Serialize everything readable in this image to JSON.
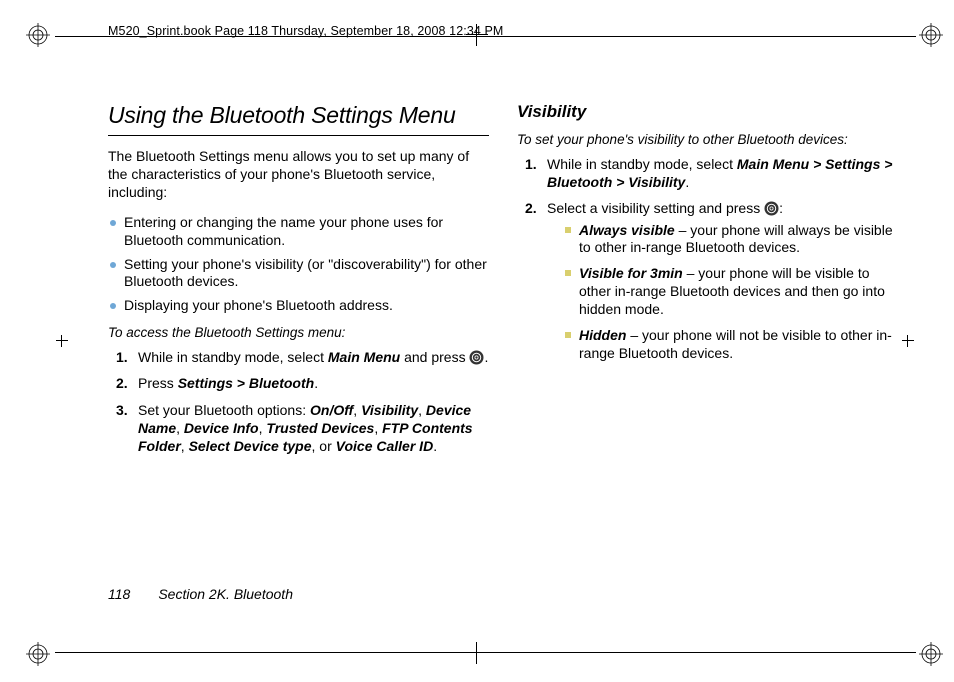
{
  "book_header": "M520_Sprint.book  Page 118  Thursday, September 18, 2008  12:34 PM",
  "left": {
    "h1": "Using the Bluetooth Settings Menu",
    "intro": "The Bluetooth Settings menu allows you to set up many of the characteristics of your phone's Bluetooth service, including:",
    "bullets": {
      "b1": "Entering or changing the name your phone uses for Bluetooth communication.",
      "b2": "Setting your phone's visibility (or \"discoverability\") for other Bluetooth devices.",
      "b3": "Displaying your phone's Bluetooth address."
    },
    "leadin": "To access the Bluetooth Settings menu:",
    "steps": {
      "s1a": "While in standby mode, select ",
      "s1b": "Main Menu",
      "s1c": " and press ",
      "s1d": ".",
      "s2a": "Press ",
      "s2b": "Settings > Bluetooth",
      "s2c": ".",
      "s3a": "Set your Bluetooth options: ",
      "s3_on": "On/Off",
      "s3_vis": "Visibility",
      "s3_dn": "Device Name",
      "s3_di": "Device Info",
      "s3_td": "Trusted Devices",
      "s3_ftp": "FTP Contents Folder",
      "s3_sdt": "Select Device type",
      "s3_or": ", or ",
      "s3_vci": "Voice Caller ID",
      "s3_end": "."
    }
  },
  "right": {
    "h2": "Visibility",
    "leadin": "To set your phone's visibility to other Bluetooth devices:",
    "steps": {
      "s1a": "While in standby mode, select ",
      "s1b": "Main Menu > Settings > Bluetooth > Visibility",
      "s1c": ".",
      "s2a": "Select a visibility setting and press ",
      "s2b": ":"
    },
    "opts": {
      "o1a": "Always visible",
      "o1b": " – your phone will always be visible to other in-range Bluetooth devices.",
      "o2a": "Visible for 3min",
      "o2b": " – your phone will be visible to other in-range Bluetooth devices and then go into hidden mode.",
      "o3a": "Hidden",
      "o3b": " – your phone will not be visible to other in-range Bluetooth devices."
    }
  },
  "footer": {
    "page": "118",
    "section": "Section 2K. Bluetooth"
  }
}
